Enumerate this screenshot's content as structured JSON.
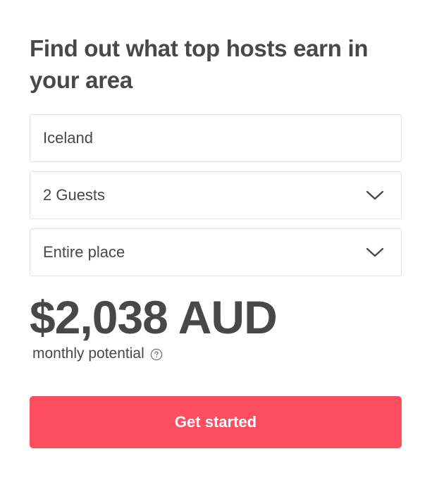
{
  "header": {
    "title": "Find out what top hosts earn in your area"
  },
  "form": {
    "location": {
      "value": "Iceland"
    },
    "guests": {
      "selected": "2 Guests",
      "icon": "chevron-down-icon"
    },
    "place_type": {
      "selected": "Entire place",
      "icon": "chevron-down-icon"
    }
  },
  "estimate": {
    "amount": "$2,038 AUD",
    "label": "monthly potential",
    "help_icon": "question-circle-icon"
  },
  "cta": {
    "label": "Get started",
    "color": "#fc4e5f"
  },
  "colors": {
    "text": "#484848",
    "border": "#e4e4e4",
    "accent": "#fc4e5f"
  }
}
